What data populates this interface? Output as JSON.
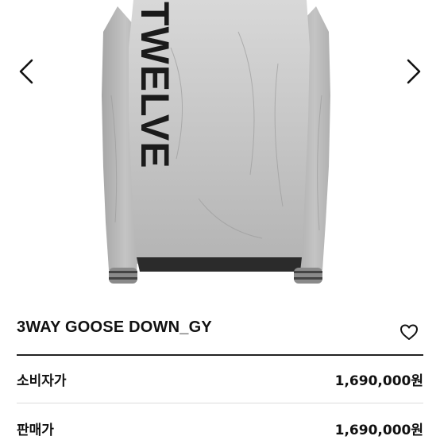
{
  "gallery": {
    "image_icon": "jacket-back-photo",
    "brand_print": "TWELVE",
    "prev_icon": "chevron-left-icon",
    "next_icon": "chevron-right-icon"
  },
  "product": {
    "title": "3WAY GOOSE DOWN_GY",
    "wishlist_icon": "heart-outline-icon"
  },
  "prices": [
    {
      "label": "소비자가",
      "value": "1,690,000원"
    },
    {
      "label": "판매가",
      "value": "1,690,000원"
    }
  ],
  "colors": {
    "jacket": "#b9b9b9",
    "print": "#1a1a1a",
    "divider": "#222222"
  }
}
